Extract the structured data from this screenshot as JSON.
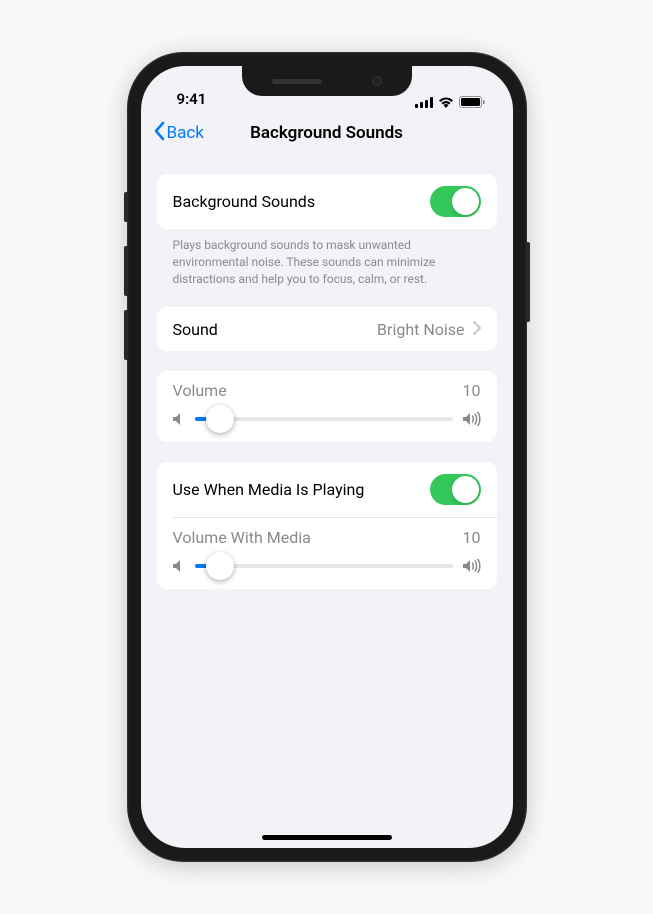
{
  "statusBar": {
    "time": "9:41"
  },
  "navBar": {
    "backLabel": "Back",
    "title": "Background Sounds"
  },
  "mainToggle": {
    "label": "Background Sounds",
    "enabled": true,
    "description": "Plays background sounds to mask unwanted environmental noise. These sounds can minimize distractions and help you to focus, calm, or rest."
  },
  "sound": {
    "label": "Sound",
    "value": "Bright Noise"
  },
  "volume": {
    "label": "Volume",
    "value": "10",
    "percent": 10
  },
  "mediaToggle": {
    "label": "Use When Media Is Playing",
    "enabled": true
  },
  "volumeWithMedia": {
    "label": "Volume With Media",
    "value": "10",
    "percent": 10
  }
}
